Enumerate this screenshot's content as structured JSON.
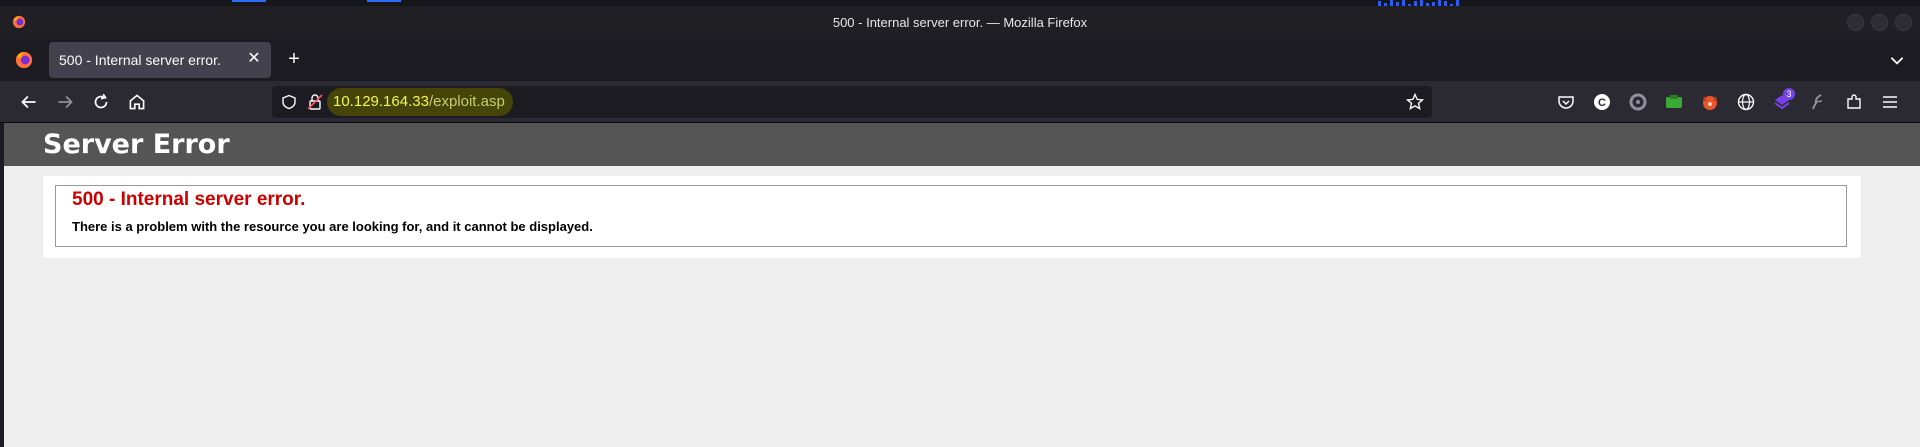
{
  "window": {
    "title": "500 - Internal server error. — Mozilla Firefox"
  },
  "tabs": [
    {
      "label": "500 - Internal server error."
    }
  ],
  "address_bar": {
    "host": "10.129.164.33",
    "path": "/exploit.asp"
  },
  "extensions": {
    "badge_count": "3"
  },
  "page": {
    "header": "Server Error",
    "error_title": "500 - Internal server error.",
    "error_message": "There is a problem with the resource you are looking for, and it cannot be displayed."
  },
  "colors": {
    "url_highlight": "#45450a",
    "host_text": "#f5f554",
    "error_red": "#cc0000",
    "header_bg": "#555555"
  }
}
